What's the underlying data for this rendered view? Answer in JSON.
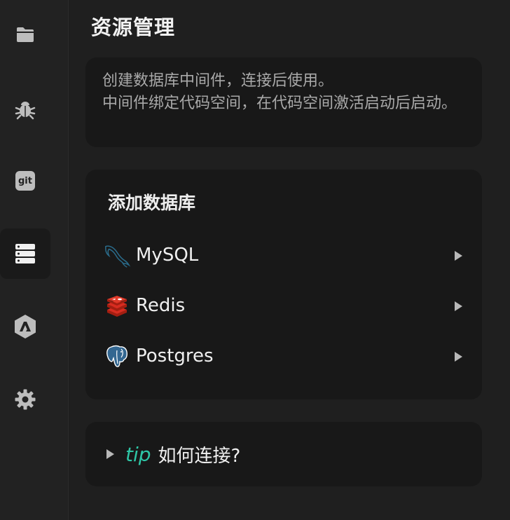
{
  "sidebar": {
    "items": [
      {
        "name": "folder",
        "icon": "folder-icon",
        "active": false
      },
      {
        "name": "debug",
        "icon": "bug-icon",
        "active": false
      },
      {
        "name": "git",
        "icon": "git-icon",
        "label": "git",
        "active": false
      },
      {
        "name": "resources",
        "icon": "database-stack-icon",
        "active": true
      },
      {
        "name": "brand",
        "icon": "hexagon-logo-icon",
        "active": false
      },
      {
        "name": "settings",
        "icon": "gear-icon",
        "active": false
      }
    ]
  },
  "header": {
    "title": "资源管理"
  },
  "description": {
    "text": "创建数据库中间件，连接后使用。\n中间件绑定代码空间，在代码空间激活启动后启动。"
  },
  "add_database": {
    "title": "添加数据库",
    "items": [
      {
        "label": "MySQL",
        "icon": "mysql-dolphin-icon"
      },
      {
        "label": "Redis",
        "icon": "redis-cube-icon"
      },
      {
        "label": "Postgres",
        "icon": "postgres-elephant-icon"
      }
    ]
  },
  "tip": {
    "badge": "tip",
    "text": "如何连接?"
  },
  "colors": {
    "background": "#1f1f1f",
    "card": "#181818",
    "accent": "#2ec6a6",
    "redis": "#d82c20",
    "postgres": "#336791"
  }
}
